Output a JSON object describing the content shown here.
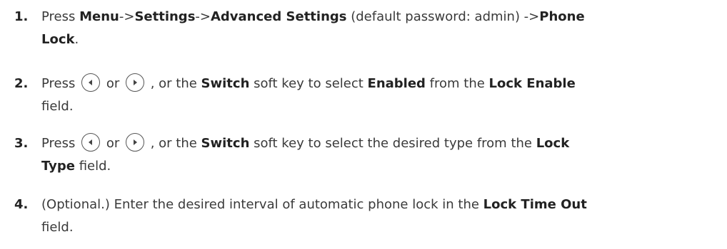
{
  "steps": [
    {
      "number": "1.",
      "parts": {
        "p1": "Press ",
        "menu": "Menu",
        "arrow1": "->",
        "settings": "Settings",
        "arrow2": "->",
        "advanced": "Advanced Settings",
        "note": " (default password: admin) ->",
        "phone": "Phone",
        "lock": "Lock",
        "end": "."
      }
    },
    {
      "number": "2.",
      "parts": {
        "press": "Press",
        "or": " or ",
        "after_keys": " , or the ",
        "switch": "Switch",
        "soft_key": " soft key to select ",
        "enabled": "Enabled",
        "from": " from the ",
        "lock_enable": "Lock Enable",
        "field": "field."
      },
      "keys": [
        "left-arrow-key",
        "right-arrow-key"
      ]
    },
    {
      "number": "3.",
      "parts": {
        "press": "Press",
        "or": " or ",
        "after_keys": " , or the ",
        "switch": "Switch",
        "soft_key": " soft key to select the desired type from the ",
        "lock": "Lock",
        "type": "Type",
        "field": " field."
      },
      "keys": [
        "left-arrow-key",
        "right-arrow-key"
      ]
    },
    {
      "number": "4.",
      "parts": {
        "text": "(Optional.) Enter the desired interval of automatic phone lock in the ",
        "lock_time_out": "Lock Time Out",
        "field": "field."
      }
    }
  ],
  "colors": {
    "text": "#3a3a3a",
    "bold": "#222222",
    "key_border": "#555555"
  }
}
